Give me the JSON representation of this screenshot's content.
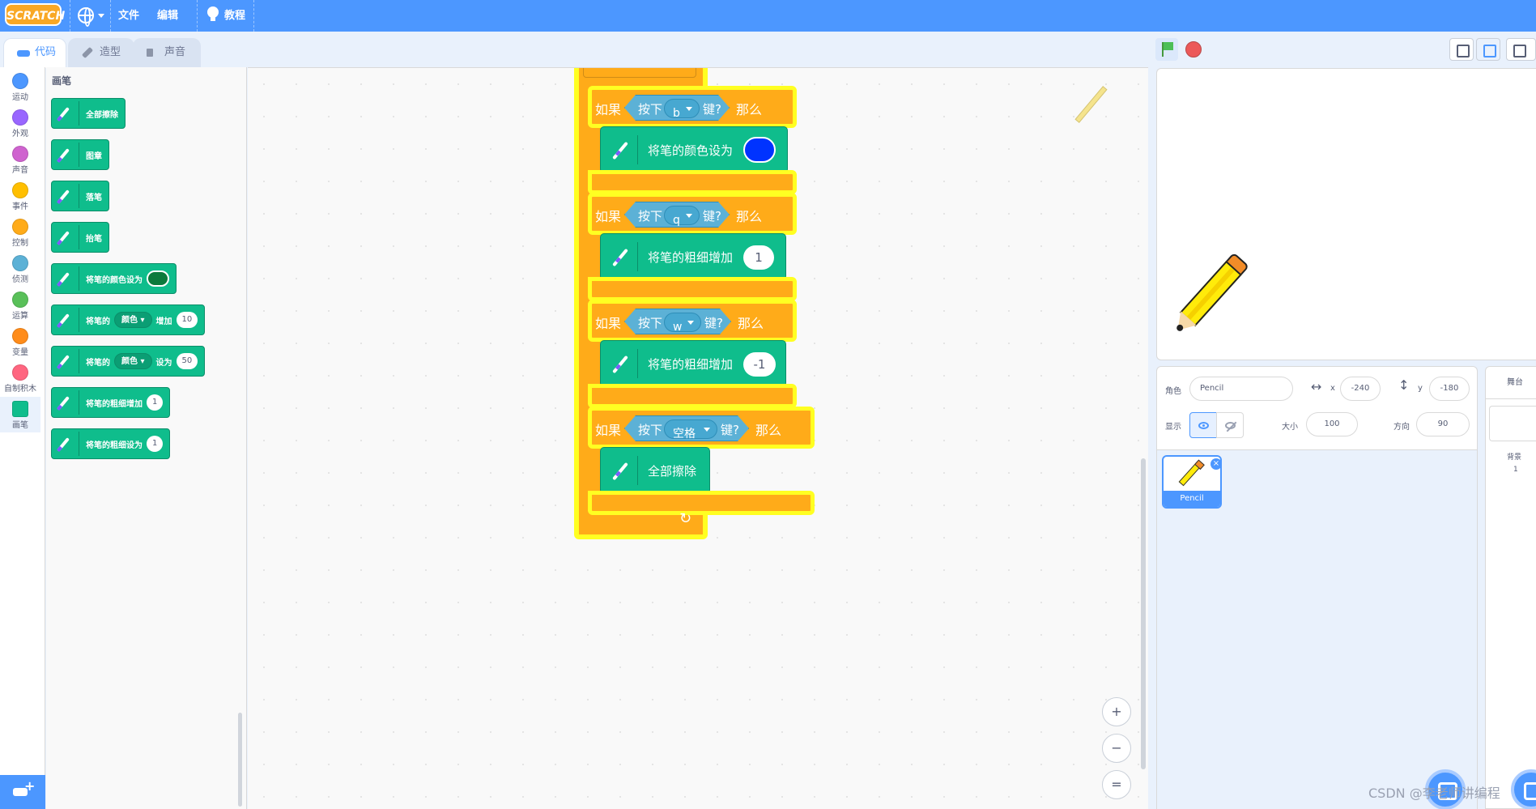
{
  "menu": {
    "logo": "SCRATCH",
    "file": "文件",
    "edit": "编辑",
    "tutorials": "教程"
  },
  "tabs": {
    "code": "代码",
    "costumes": "造型",
    "sounds": "声音"
  },
  "categories": [
    {
      "label": "运动",
      "color": "#4c97ff"
    },
    {
      "label": "外观",
      "color": "#9966ff"
    },
    {
      "label": "声音",
      "color": "#cf63cf"
    },
    {
      "label": "事件",
      "color": "#ffbf00"
    },
    {
      "label": "控制",
      "color": "#ffab19"
    },
    {
      "label": "侦测",
      "color": "#5cb1d6"
    },
    {
      "label": "运算",
      "color": "#59c059"
    },
    {
      "label": "变量",
      "color": "#ff8c1a"
    },
    {
      "label": "自制积木",
      "color": "#ff6680"
    },
    {
      "label": "画笔",
      "color": "#0fbd8c"
    }
  ],
  "palette": {
    "title": "画笔",
    "blocks": {
      "clear": "全部擦除",
      "stamp": "图章",
      "pen_down": "落笔",
      "pen_up": "抬笔",
      "set_color": "将笔的颜色设为",
      "set_color_swatch": "#0b7a3c",
      "change_param_prefix": "将笔的",
      "change_param_drop": "颜色",
      "change_param_mid": "增加",
      "change_param_value": "10",
      "set_param_prefix": "将笔的",
      "set_param_drop": "颜色",
      "set_param_mid": "设为",
      "set_param_value": "50",
      "change_size": "将笔的粗细增加",
      "change_size_value": "1",
      "set_size": "将笔的粗细设为",
      "set_size_value": "1"
    }
  },
  "script": {
    "if_label": "如果",
    "then_label": "那么",
    "key_pressed": "按下",
    "key_suffix": "键?",
    "branches": [
      {
        "key": "b",
        "action": "将笔的颜色设为",
        "color": "#0033ff"
      },
      {
        "key": "q",
        "action": "将笔的粗细增加",
        "value": "1"
      },
      {
        "key": "w",
        "action": "将笔的粗细增加",
        "value": "-1"
      },
      {
        "key": "空格",
        "action": "全部擦除"
      }
    ]
  },
  "zoom": {
    "in": "+",
    "out": "−",
    "reset": "="
  },
  "sprite_info": {
    "sprite_label": "角色",
    "sprite_name": "Pencil",
    "x_label": "x",
    "x_value": "-240",
    "y_label": "y",
    "y_value": "-180",
    "show_label": "显示",
    "size_label": "大小",
    "size_value": "100",
    "direction_label": "方向",
    "direction_value": "90"
  },
  "sprites": [
    {
      "name": "Pencil"
    }
  ],
  "stage_pane": {
    "title": "舞台",
    "backdrops_label": "背景",
    "backdrops_count": "1"
  },
  "watermark": "CSDN @李老师讲编程"
}
